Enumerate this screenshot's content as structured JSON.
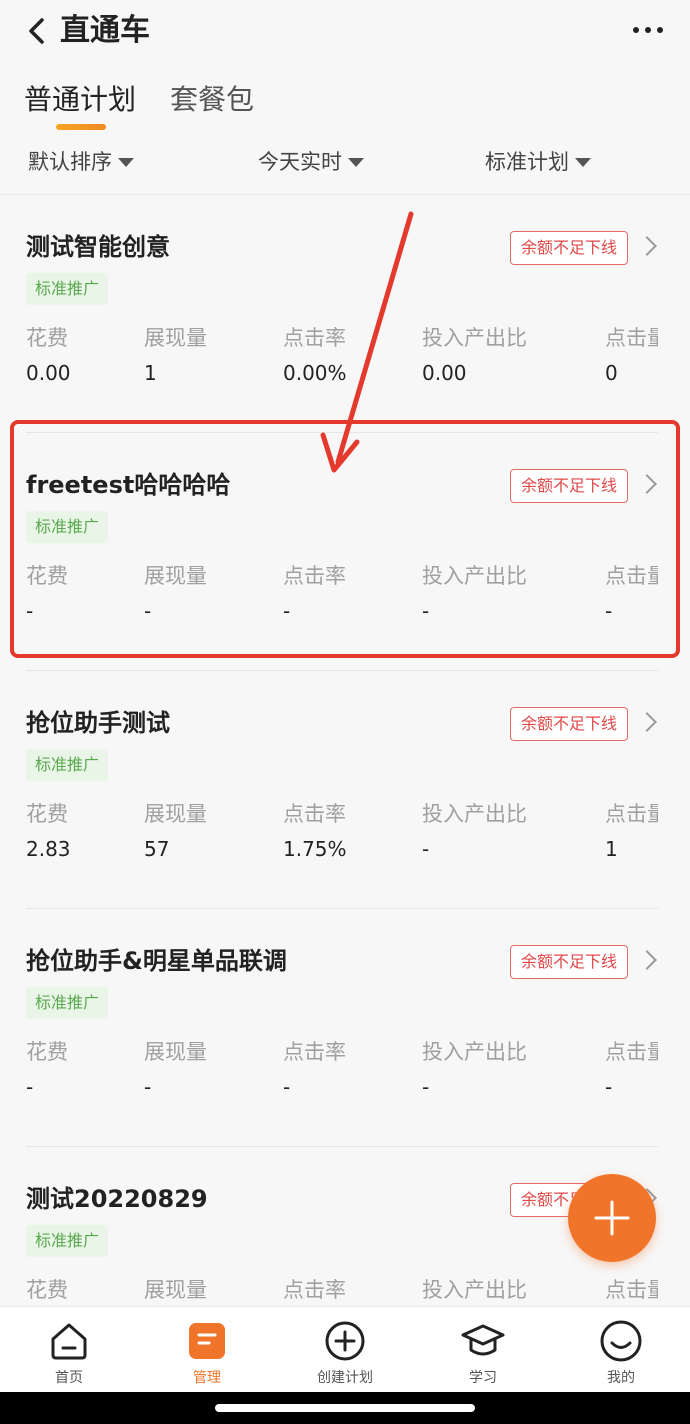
{
  "header": {
    "title": "直通车"
  },
  "tabs": [
    {
      "label": "普通计划",
      "active": true
    },
    {
      "label": "套餐包",
      "active": false
    }
  ],
  "filters": [
    {
      "label": "默认排序"
    },
    {
      "label": "今天实时"
    },
    {
      "label": "标准计划"
    }
  ],
  "metric_labels": [
    "花费",
    "展现量",
    "点击率",
    "投入产出比",
    "点击量"
  ],
  "plans": [
    {
      "name": "测试智能创意",
      "status": "余额不足下线",
      "tag": "标准推广",
      "values": [
        "0.00",
        "1",
        "0.00%",
        "0.00",
        "0"
      ]
    },
    {
      "name": "freetest哈哈哈哈",
      "status": "余额不足下线",
      "tag": "标准推广",
      "values": [
        "-",
        "-",
        "-",
        "-",
        "-"
      ]
    },
    {
      "name": "抢位助手测试",
      "status": "余额不足下线",
      "tag": "标准推广",
      "values": [
        "2.83",
        "57",
        "1.75%",
        "-",
        "1"
      ]
    },
    {
      "name": "抢位助手&明星单品联调",
      "status": "余额不足下线",
      "tag": "标准推广",
      "values": [
        "-",
        "-",
        "-",
        "-",
        "-"
      ]
    },
    {
      "name": "测试20220829",
      "status": "余额不足下线",
      "tag": "标准推广",
      "values": [
        "",
        "",
        "",
        "",
        ""
      ]
    }
  ],
  "tabbar": [
    {
      "label": "首页",
      "icon": "home-icon",
      "active": false
    },
    {
      "label": "管理",
      "icon": "manage-icon",
      "active": true
    },
    {
      "label": "创建计划",
      "icon": "add-circle-icon",
      "active": false
    },
    {
      "label": "学习",
      "icon": "graduation-cap-icon",
      "active": false
    },
    {
      "label": "我的",
      "icon": "smile-icon",
      "active": false
    }
  ],
  "colors": {
    "accent": "#f0742a",
    "annotation": "#e43a2e",
    "status_red": "#e04848",
    "tag_green": "#5aa84f"
  }
}
